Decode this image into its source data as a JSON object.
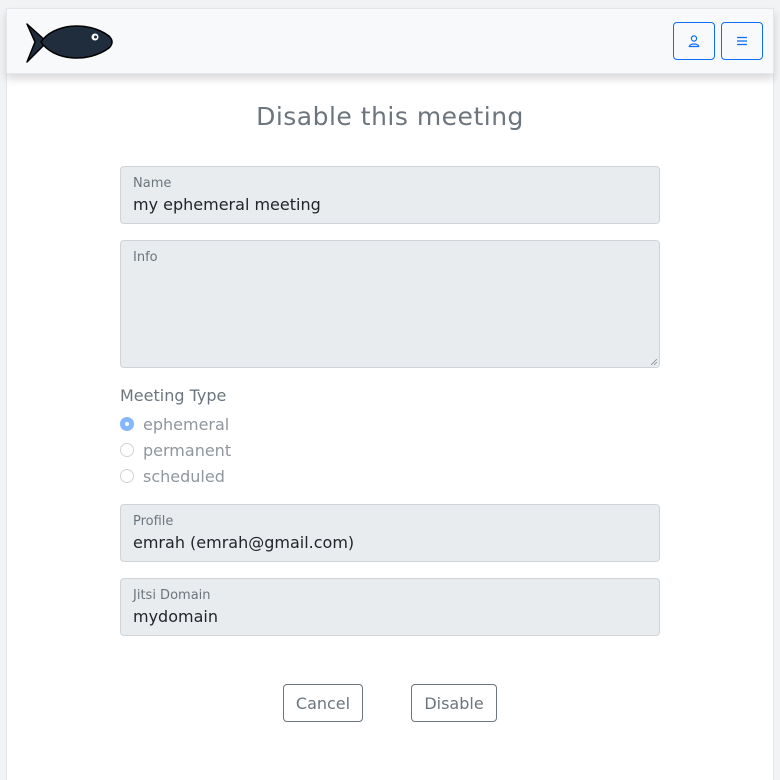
{
  "header": {
    "logo_icon": "fish-icon",
    "user_icon": "person-icon",
    "menu_icon": "hamburger-menu-icon",
    "accent_color": "#0d6efd"
  },
  "page": {
    "title": "Disable this meeting"
  },
  "form": {
    "name": {
      "label": "Name",
      "value": "my ephemeral meeting"
    },
    "info": {
      "label": "Info",
      "value": ""
    },
    "meeting_type": {
      "label": "Meeting Type",
      "options": [
        "ephemeral",
        "permanent",
        "scheduled"
      ],
      "selected": "ephemeral"
    },
    "profile": {
      "label": "Profile",
      "value": "emrah (emrah@gmail.com)"
    },
    "jitsi_domain": {
      "label": "Jitsi Domain",
      "value": "mydomain"
    }
  },
  "actions": {
    "cancel_label": "Cancel",
    "disable_label": "Disable"
  }
}
